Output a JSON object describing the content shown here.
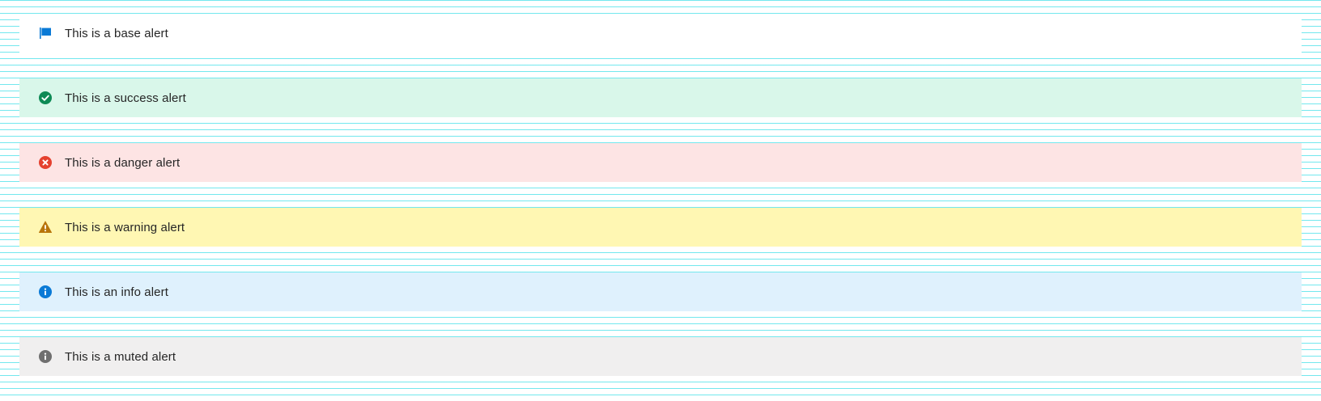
{
  "alerts": [
    {
      "variant": "base",
      "text": "This is a base alert",
      "icon": "flag-icon",
      "background": "#ffffff",
      "icon_color": "#0a7ad6"
    },
    {
      "variant": "success",
      "text": "This is a success alert",
      "icon": "check-circle-icon",
      "background": "#d9f7ea",
      "icon_color": "#0e8a55"
    },
    {
      "variant": "danger",
      "text": "This is a danger alert",
      "icon": "x-circle-icon",
      "background": "#fde4e4",
      "icon_color": "#e5412f"
    },
    {
      "variant": "warning",
      "text": "This is a warning alert",
      "icon": "warning-triangle-icon",
      "background": "#fff7b3",
      "icon_color": "#b8750a"
    },
    {
      "variant": "info",
      "text": "This is an info alert",
      "icon": "info-circle-icon",
      "background": "#dff1fd",
      "icon_color": "#0a7ad6"
    },
    {
      "variant": "muted",
      "text": "This is a muted alert",
      "icon": "info-circle-icon",
      "background": "#f0efef",
      "icon_color": "#6f6f6f"
    }
  ],
  "baseline_grid_color": "#00d4e0"
}
